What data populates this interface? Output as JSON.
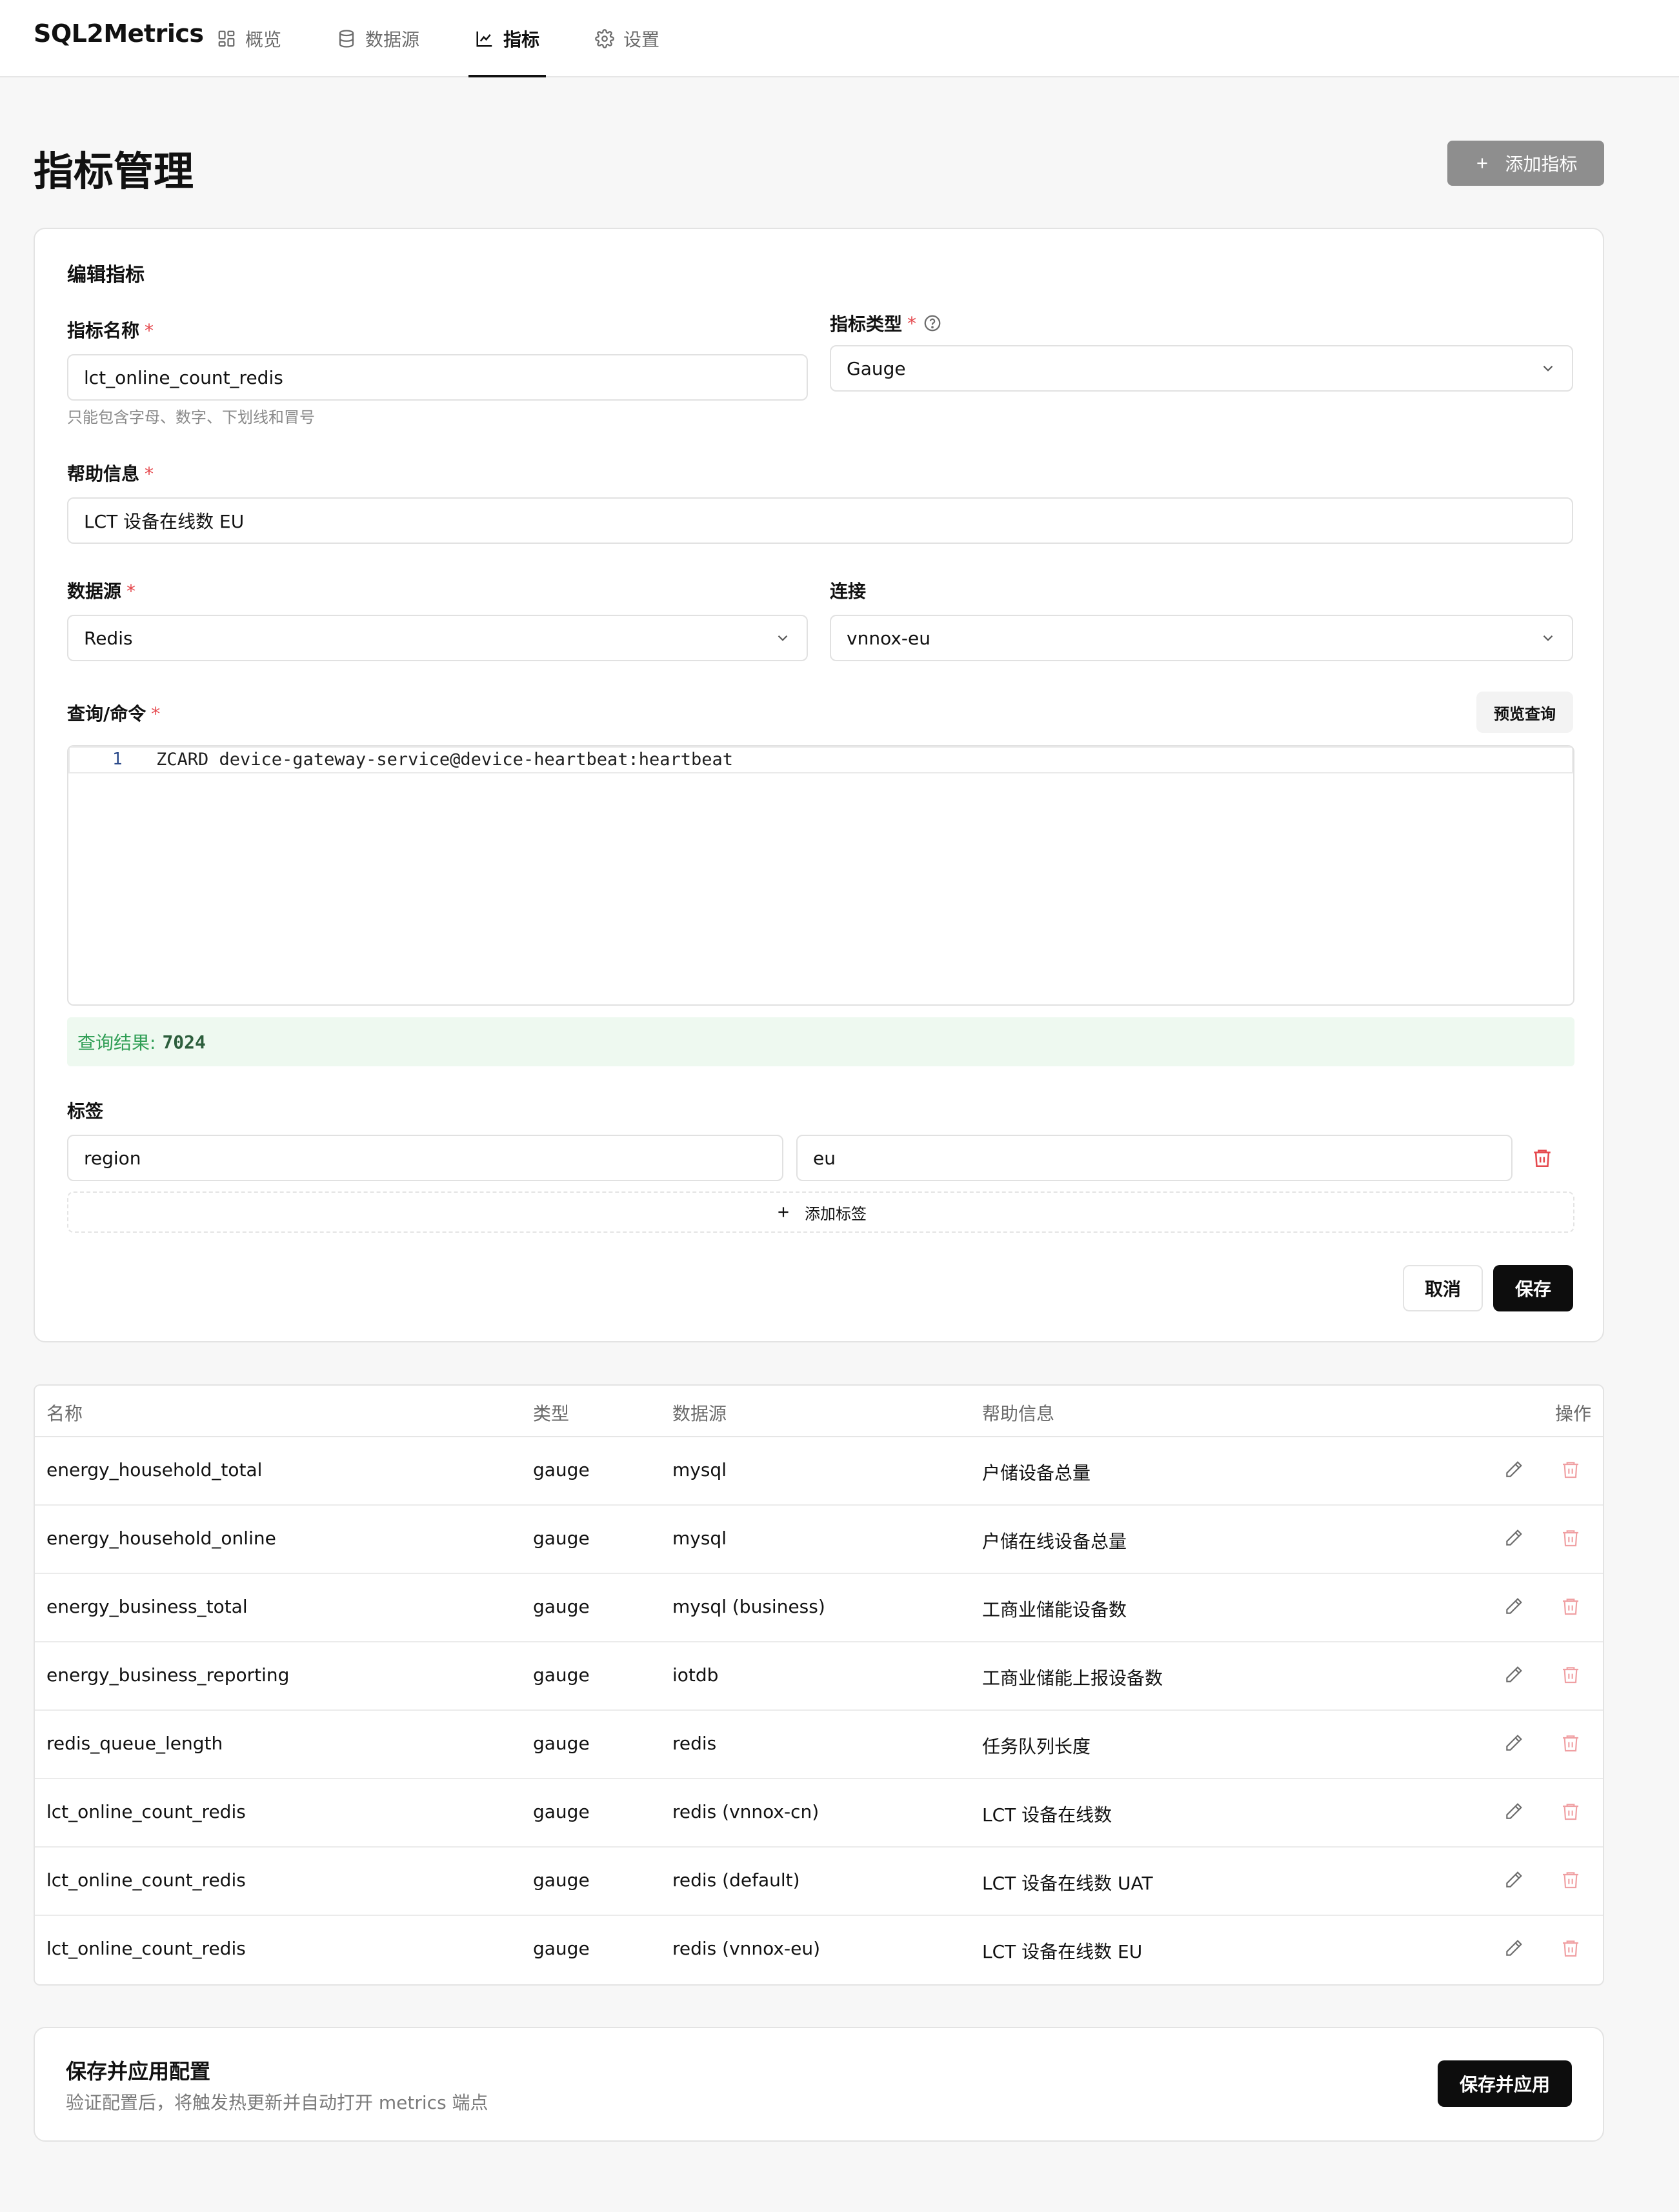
{
  "app": {
    "brand": "SQL2Metrics"
  },
  "nav": {
    "items": [
      {
        "label": "概览",
        "icon": "dashboard-icon"
      },
      {
        "label": "数据源",
        "icon": "database-icon"
      },
      {
        "label": "指标",
        "icon": "chart-line-icon",
        "active": true
      },
      {
        "label": "设置",
        "icon": "gear-icon"
      }
    ]
  },
  "header": {
    "title": "指标管理",
    "add_button": "添加指标"
  },
  "form": {
    "title": "编辑指标",
    "name": {
      "label": "指标名称",
      "required": "*",
      "value": "lct_online_count_redis",
      "hint": "只能包含字母、数字、下划线和冒号"
    },
    "type": {
      "label": "指标类型",
      "required": "*",
      "value": "Gauge"
    },
    "help": {
      "label": "帮助信息",
      "required": "*",
      "value": "LCT 设备在线数 EU"
    },
    "datasource": {
      "label": "数据源",
      "required": "*",
      "value": "Redis"
    },
    "connection": {
      "label": "连接",
      "value": "vnnox-eu"
    },
    "query": {
      "label": "查询/命令",
      "required": "*",
      "preview_button": "预览查询",
      "line_number": "1",
      "code": "ZCARD device-gateway-service@device-heartbeat:heartbeat",
      "result_label": "查询结果:",
      "result_value": "7024"
    },
    "tags": {
      "label": "标签",
      "items": [
        {
          "key": "region",
          "value": "eu"
        }
      ],
      "add_button": "添加标签"
    },
    "cancel_button": "取消",
    "save_button": "保存"
  },
  "table": {
    "columns": [
      "名称",
      "类型",
      "数据源",
      "帮助信息",
      "操作"
    ],
    "rows": [
      {
        "name": "energy_household_total",
        "type": "gauge",
        "source": "mysql",
        "help": "户储设备总量"
      },
      {
        "name": "energy_household_online",
        "type": "gauge",
        "source": "mysql",
        "help": "户储在线设备总量"
      },
      {
        "name": "energy_business_total",
        "type": "gauge",
        "source": "mysql (business)",
        "help": "工商业储能设备数"
      },
      {
        "name": "energy_business_reporting",
        "type": "gauge",
        "source": "iotdb",
        "help": "工商业储能上报设备数"
      },
      {
        "name": "redis_queue_length",
        "type": "gauge",
        "source": "redis",
        "help": "任务队列长度"
      },
      {
        "name": "lct_online_count_redis",
        "type": "gauge",
        "source": "redis (vnnox-cn)",
        "help": "LCT 设备在线数"
      },
      {
        "name": "lct_online_count_redis",
        "type": "gauge",
        "source": "redis (default)",
        "help": "LCT 设备在线数 UAT"
      },
      {
        "name": "lct_online_count_redis",
        "type": "gauge",
        "source": "redis (vnnox-eu)",
        "help": "LCT 设备在线数 EU"
      }
    ]
  },
  "apply": {
    "title": "保存并应用配置",
    "description": "验证配置后，将触发热更新并自动打开 metrics 端点",
    "button": "保存并应用"
  },
  "colors": {
    "accent": "#0d0d0d",
    "danger": "#e5484d",
    "success_bg": "#eef9f0",
    "success_text": "#2f9e55"
  }
}
